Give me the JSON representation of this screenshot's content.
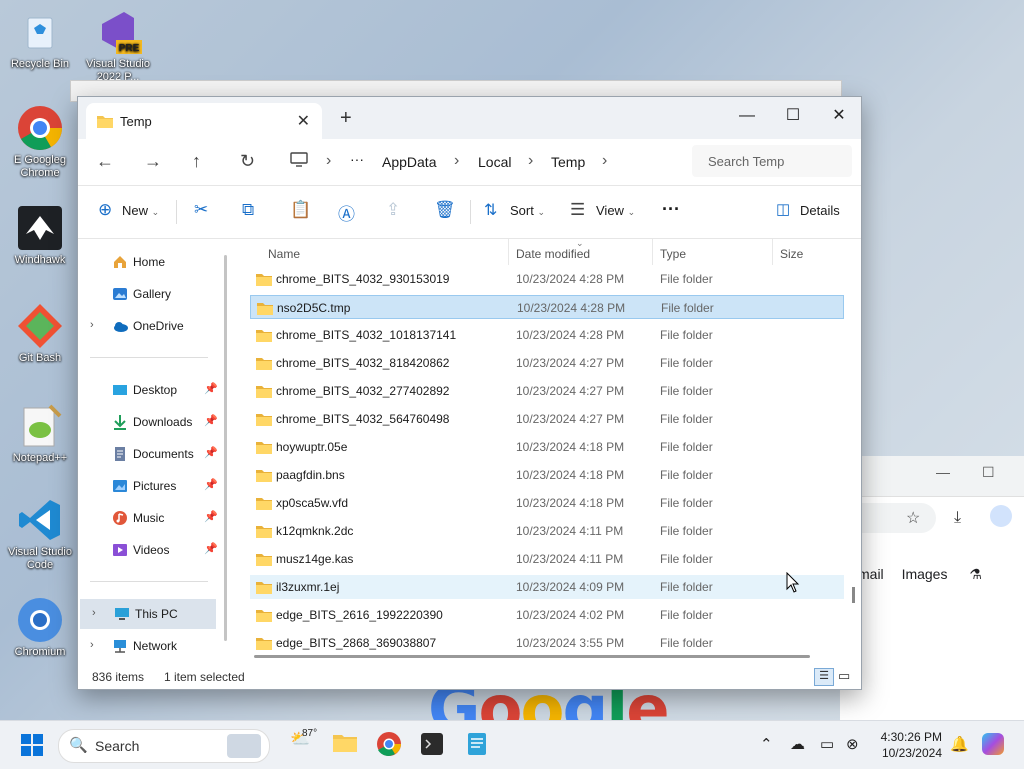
{
  "desktop": {
    "icons": [
      {
        "label": "Recycle Bin"
      },
      {
        "label": "Visual Studio 2022 P..."
      },
      {
        "label": "E Googleg Chrome"
      },
      {
        "label": "Windhawk"
      },
      {
        "label": "Git Bash"
      },
      {
        "label": "Notepad++"
      },
      {
        "label": "Visual Studio Code"
      },
      {
        "label": "Chromium"
      }
    ],
    "vs_badge": "PRE"
  },
  "chrome_bg": {
    "links": [
      "mail",
      "Images"
    ],
    "google_text": "Google"
  },
  "explorer": {
    "tab_title": "Temp",
    "new_tab": "+",
    "controls": {
      "minimize": "—",
      "maximize": "☐",
      "close": "✕"
    },
    "breadcrumbs": [
      "AppData",
      "Local",
      "Temp"
    ],
    "breadcrumb_more": "···",
    "search_placeholder": "Search Temp",
    "toolbar": {
      "new_label": "New",
      "sort_label": "Sort",
      "view_label": "View",
      "more_label": "···",
      "details_label": "Details"
    },
    "sidebar": {
      "home": "Home",
      "gallery": "Gallery",
      "onedrive": "OneDrive",
      "quick": [
        {
          "label": "Desktop"
        },
        {
          "label": "Downloads"
        },
        {
          "label": "Documents"
        },
        {
          "label": "Pictures"
        },
        {
          "label": "Music"
        },
        {
          "label": "Videos"
        }
      ],
      "this_pc": "This PC",
      "network": "Network"
    },
    "columns": {
      "name": "Name",
      "date": "Date modified",
      "type": "Type",
      "size": "Size"
    },
    "rows": [
      {
        "name": "chrome_BITS_4032_930153019",
        "date": "10/23/2024 4:28 PM",
        "type": "File folder"
      },
      {
        "name": "nso2D5C.tmp",
        "date": "10/23/2024 4:28 PM",
        "type": "File folder"
      },
      {
        "name": "chrome_BITS_4032_1018137141",
        "date": "10/23/2024 4:28 PM",
        "type": "File folder"
      },
      {
        "name": "chrome_BITS_4032_818420862",
        "date": "10/23/2024 4:27 PM",
        "type": "File folder"
      },
      {
        "name": "chrome_BITS_4032_277402892",
        "date": "10/23/2024 4:27 PM",
        "type": "File folder"
      },
      {
        "name": "chrome_BITS_4032_564760498",
        "date": "10/23/2024 4:27 PM",
        "type": "File folder"
      },
      {
        "name": "hoywuptr.05e",
        "date": "10/23/2024 4:18 PM",
        "type": "File folder"
      },
      {
        "name": "paagfdin.bns",
        "date": "10/23/2024 4:18 PM",
        "type": "File folder"
      },
      {
        "name": "xp0sca5w.vfd",
        "date": "10/23/2024 4:18 PM",
        "type": "File folder"
      },
      {
        "name": "k12qmknk.2dc",
        "date": "10/23/2024 4:11 PM",
        "type": "File folder"
      },
      {
        "name": "musz14ge.kas",
        "date": "10/23/2024 4:11 PM",
        "type": "File folder"
      },
      {
        "name": "il3zuxmr.1ej",
        "date": "10/23/2024 4:09 PM",
        "type": "File folder"
      },
      {
        "name": "edge_BITS_2616_1992220390",
        "date": "10/23/2024 4:02 PM",
        "type": "File folder"
      },
      {
        "name": "edge_BITS_2868_369038807",
        "date": "10/23/2024 3:55 PM",
        "type": "File folder"
      }
    ],
    "selected_index": 1,
    "hover_index": 11,
    "status": {
      "count": "836 items",
      "selected": "1 item selected"
    }
  },
  "taskbar": {
    "search_label": "Search",
    "weather": "87°",
    "time": "4:30:26 PM",
    "date": "10/23/2024"
  },
  "colors": {
    "accent": "#1a6fc9",
    "folder": "#f4c550",
    "selection": "#cce4f7"
  }
}
